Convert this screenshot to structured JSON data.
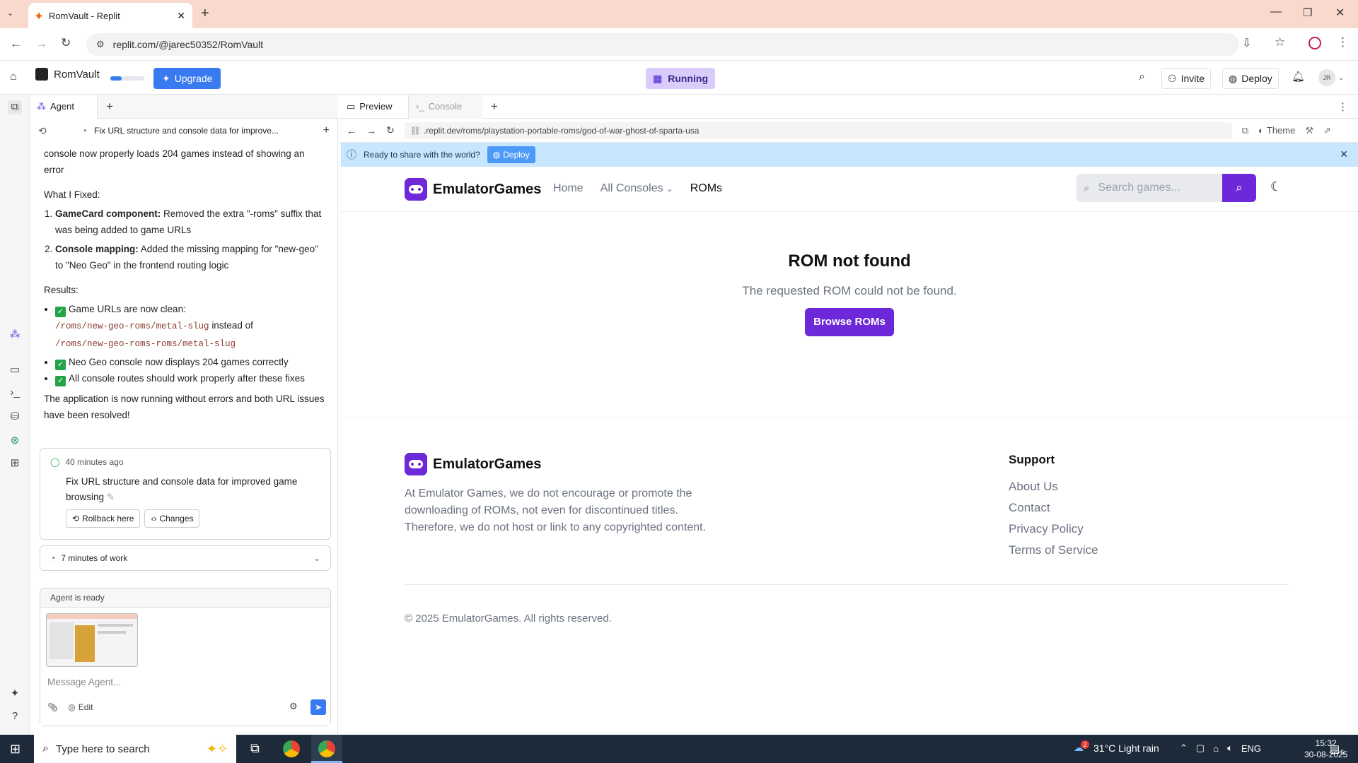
{
  "browser": {
    "tab_title": "RomVault - Replit",
    "url": "replit.com/@jarec50352/RomVault"
  },
  "replit": {
    "project_name": "RomVault",
    "upgrade_label": "Upgrade",
    "status": "Running",
    "invite_label": "Invite",
    "deploy_label": "Deploy",
    "avatar_initials": "JR"
  },
  "agent_panel": {
    "tab_label": "Agent",
    "thread_title": "Fix URL structure and console data for improve...",
    "intro_text": "console now properly loads 204 games instead of showing an error",
    "fixed_heading": "What I Fixed:",
    "fixes": [
      {
        "bold": "GameCard component:",
        "text": " Removed the extra \"-roms\" suffix that was being added to game URLs"
      },
      {
        "bold": "Console mapping:",
        "text": " Added the missing mapping for \"new-geo\" to \"Neo Geo\" in the frontend routing logic"
      }
    ],
    "results_heading": "Results:",
    "result_1_text": "Game URLs are now clean:",
    "result_1_code_a": "/roms/new-geo-roms/metal-slug",
    "result_1_mid": "instead of",
    "result_1_code_b": "/roms/new-geo-roms-roms/metal-slug",
    "result_2_text": "Neo Geo console now displays 204 games correctly",
    "result_3_text": "All console routes should work properly after these fixes",
    "closing_text": "The application is now running without errors and both URL issues have been resolved!",
    "checkpoint": {
      "time": "40 minutes ago",
      "message": "Fix URL structure and console data for improved game browsing",
      "rollback_label": "Rollback here",
      "changes_label": "Changes"
    },
    "work_summary": "7 minutes of work",
    "ready_label": "Agent is ready",
    "input_placeholder": "Message Agent...",
    "edit_label": "Edit"
  },
  "preview": {
    "tab_preview": "Preview",
    "tab_console": "Console",
    "url": ".replit.dev/roms/playstation-portable-roms/god-of-war-ghost-of-sparta-usa",
    "theme_label": "Theme",
    "banner_text": "Ready to share with the world?",
    "banner_button": "Deploy"
  },
  "site": {
    "brand": "EmulatorGames",
    "nav": [
      "Home",
      "All Consoles",
      "ROMs"
    ],
    "search_placeholder": "Search games...",
    "error_title": "ROM not found",
    "error_message": "The requested ROM could not be found.",
    "browse_button": "Browse ROMs",
    "footer_brand": "EmulatorGames",
    "footer_text": "At Emulator Games, we do not encourage or promote the downloading of ROMs, not even for discontinued titles. Therefore, we do not host or link to any copyrighted content.",
    "support_heading": "Support",
    "support_links": [
      "About Us",
      "Contact",
      "Privacy Policy",
      "Terms of Service"
    ],
    "copyright": "© 2025 EmulatorGames. All rights reserved."
  },
  "taskbar": {
    "search_placeholder": "Type here to search",
    "weather": "31°C  Light rain",
    "language": "ENG",
    "time": "15:32",
    "date": "30-08-2025",
    "weather_badge": "2",
    "notification_count": "5"
  }
}
